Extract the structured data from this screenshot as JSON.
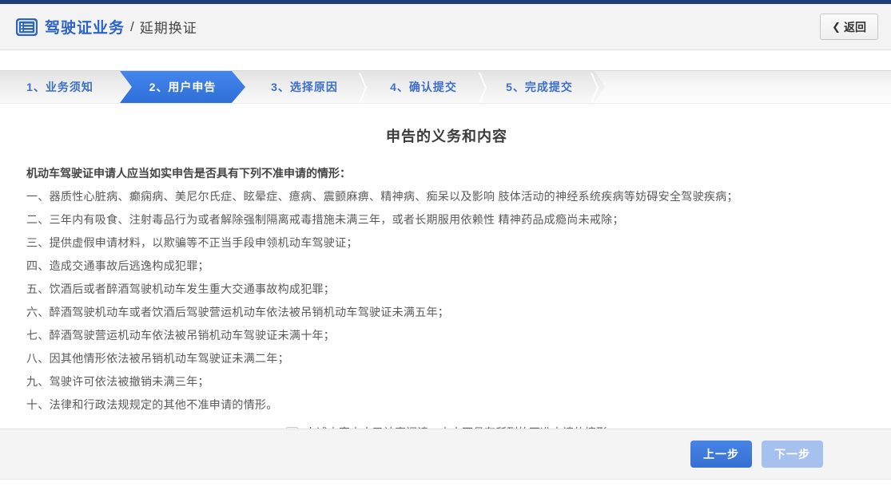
{
  "header": {
    "breadcrumb_primary": "驾驶证业务",
    "breadcrumb_separator": "/",
    "breadcrumb_secondary": "延期换证",
    "back_chevron": "❮",
    "back_label": "返回"
  },
  "steps": {
    "active_label": "2、用户申告",
    "items": [
      {
        "label": "1、业务须知",
        "active": false
      },
      {
        "label": "2、用户申告",
        "active": true
      },
      {
        "label": "3、选择原因",
        "active": false
      },
      {
        "label": "4、确认提交",
        "active": false
      },
      {
        "label": "5、完成提交",
        "active": false
      }
    ]
  },
  "main": {
    "title": "申告的义务和内容",
    "intro": "机动车驾驶证申请人应当如实申告是否具有下列不准申请的情形：",
    "items": [
      "一、器质性心脏病、癫痫病、美尼尔氏症、眩晕症、癔病、震颤麻痹、精神病、痴呆以及影响 肢体活动的神经系统疾病等妨碍安全驾驶疾病；",
      "二、三年内有吸食、注射毒品行为或者解除强制隔离戒毒措施未满三年，或者长期服用依赖性 精神药品成瘾尚未戒除；",
      "三、提供虚假申请材料，以欺骗等不正当手段申领机动车驾驶证；",
      "四、造成交通事故后逃逸构成犯罪；",
      "五、饮酒后或者醉酒驾驶机动车发生重大交通事故构成犯罪；",
      "六、醉酒驾驶机动车或者饮酒后驾驶营运机动车依法被吊销机动车驾驶证未满五年；",
      "七、醉酒驾驶营运机动车依法被吊销机动车驾驶证未满十年；",
      "八、因其他情形依法被吊销机动车驾驶证未满二年；",
      "九、驾驶许可依法被撤销未满三年；",
      "十、法律和行政法规规定的其他不准申请的情形。"
    ],
    "agreement": {
      "checked": false,
      "label": "上述内容本人已认真阅读，本人不具有所列的不准申请的情形"
    }
  },
  "footer": {
    "prev_label": "上一步",
    "next_label": "下一步"
  },
  "colors": {
    "top_strip": "#1d3c78",
    "brand_blue": "#2b63c6",
    "step_text_blue": "#3d6fc8",
    "active_step_blue": "#2e6fd9",
    "prev_button_blue": "#3b77da",
    "next_button_disabled_blue": "#a7c1ee",
    "header_bg": "#f3f3f3",
    "footer_bg": "#f4f4f4"
  }
}
